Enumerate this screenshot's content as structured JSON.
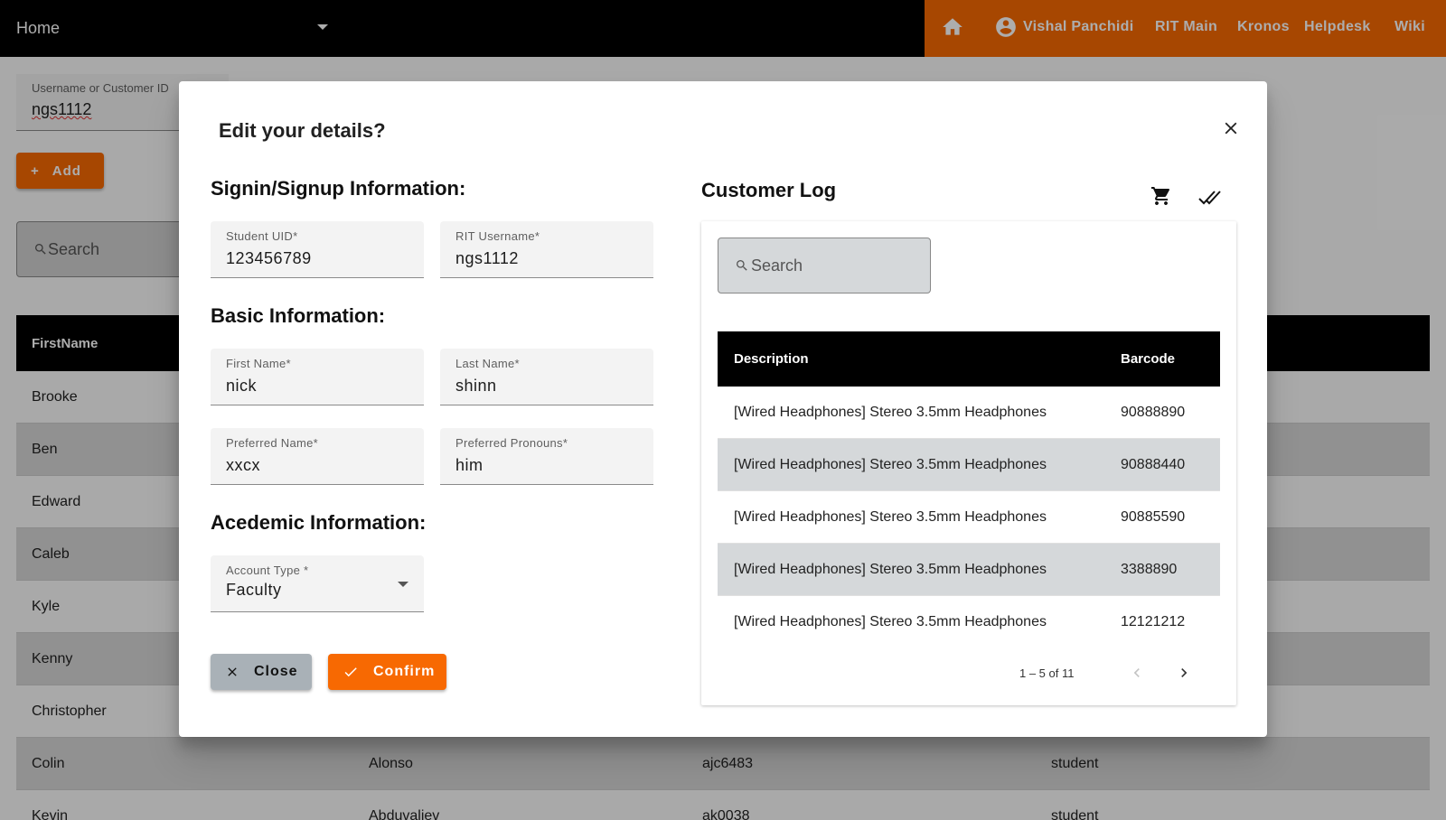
{
  "topbar": {
    "home_label": "Home",
    "user_name": "Vishal Panchidi",
    "links": [
      "RIT Main",
      "Kronos",
      "Helpdesk",
      "Wiki"
    ],
    "accent": "#f76902"
  },
  "background": {
    "username_field": {
      "label": "Username or Customer ID",
      "value": "ngs1112"
    },
    "add_label": "Add",
    "search_placeholder": "Search",
    "table_header": "FirstName",
    "rows": [
      {
        "first": "Brooke",
        "last": "",
        "username": "",
        "type": ""
      },
      {
        "first": "Ben",
        "last": "",
        "username": "",
        "type": ""
      },
      {
        "first": "Edward",
        "last": "",
        "username": "",
        "type": ""
      },
      {
        "first": "Caleb",
        "last": "",
        "username": "",
        "type": ""
      },
      {
        "first": "Kyle",
        "last": "",
        "username": "",
        "type": ""
      },
      {
        "first": "Kenny",
        "last": "",
        "username": "",
        "type": ""
      },
      {
        "first": "Christopher",
        "last": "",
        "username": "",
        "type": ""
      },
      {
        "first": "Colin",
        "last": "Alonso",
        "username": "ajc6483",
        "type": "student"
      },
      {
        "first": "Kevin",
        "last": "Abduvaliev",
        "username": "ak0038",
        "type": "student"
      }
    ]
  },
  "dialog": {
    "title": "Edit your details?",
    "signin_heading": "Signin/Signup Information:",
    "basic_heading": "Basic Information:",
    "academic_heading": "Acedemic Information:",
    "fields": {
      "student_uid": {
        "label": "Student UID*",
        "value": "123456789"
      },
      "rit_username": {
        "label": "RIT Username*",
        "value": "ngs1112"
      },
      "first_name": {
        "label": "First Name*",
        "value": "nick"
      },
      "last_name": {
        "label": "Last Name*",
        "value": "shinn"
      },
      "preferred_name": {
        "label": "Preferred Name*",
        "value": "xxcx"
      },
      "pronouns": {
        "label": "Preferred Pronouns*",
        "value": "him"
      },
      "account_type": {
        "label": "Account Type *",
        "value": "Faculty"
      }
    },
    "close_label": "Close",
    "confirm_label": "Confirm"
  },
  "log": {
    "title": "Customer Log",
    "search_placeholder": "Search",
    "columns": [
      "Description",
      "Barcode"
    ],
    "rows": [
      {
        "description": "[Wired Headphones] Stereo 3.5mm Headphones",
        "barcode": "90888890"
      },
      {
        "description": "[Wired Headphones] Stereo 3.5mm Headphones",
        "barcode": "90888440"
      },
      {
        "description": "[Wired Headphones] Stereo 3.5mm Headphones",
        "barcode": "90885590"
      },
      {
        "description": "[Wired Headphones] Stereo 3.5mm Headphones",
        "barcode": "3388890"
      },
      {
        "description": "[Wired Headphones] Stereo 3.5mm Headphones",
        "barcode": "12121212"
      }
    ],
    "range_label": "1 – 5 of 11"
  }
}
